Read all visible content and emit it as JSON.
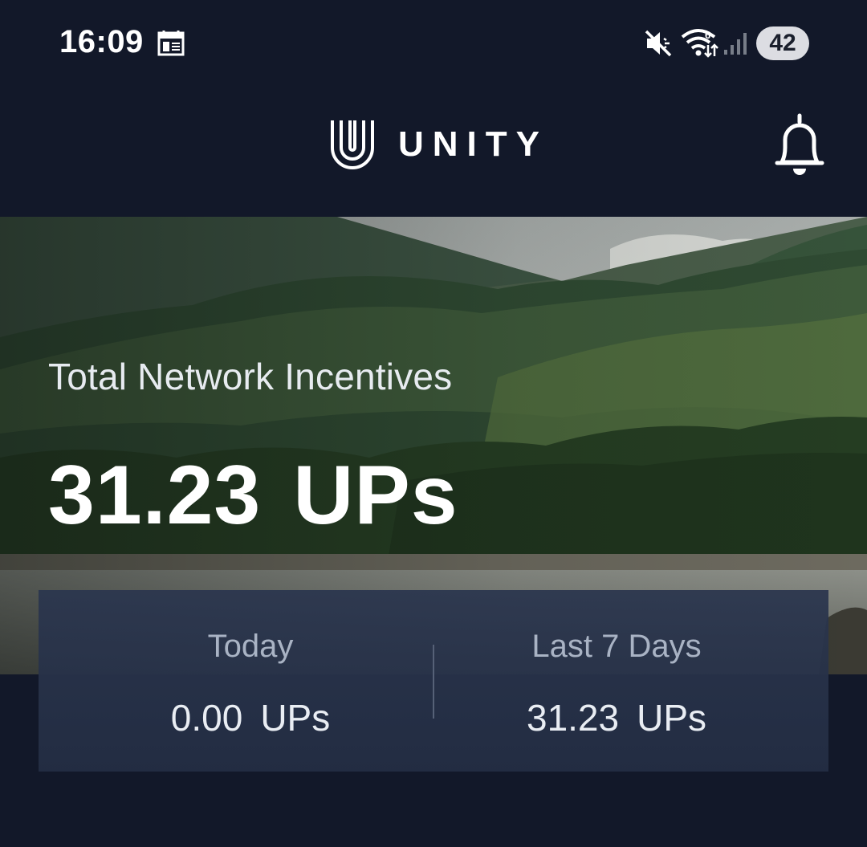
{
  "status_bar": {
    "time": "16:09",
    "battery": "42",
    "icons": [
      "calendar-icon",
      "mute-icon",
      "wifi-icon",
      "signal-icon"
    ]
  },
  "header": {
    "brand": "UNITY",
    "icons": [
      "unity-logo-icon",
      "bell-icon"
    ]
  },
  "hero": {
    "title": "Total Network Incentives",
    "value": "31.23",
    "unit": "UPs"
  },
  "stats": {
    "today": {
      "label": "Today",
      "value": "0.00",
      "unit": "UPs"
    },
    "last7": {
      "label": "Last 7 Days",
      "value": "31.23",
      "unit": "UPs"
    }
  },
  "colors": {
    "background": "#121829",
    "card": "#26304a",
    "text_primary": "#ffffff",
    "text_secondary": "#a9b3c4"
  }
}
